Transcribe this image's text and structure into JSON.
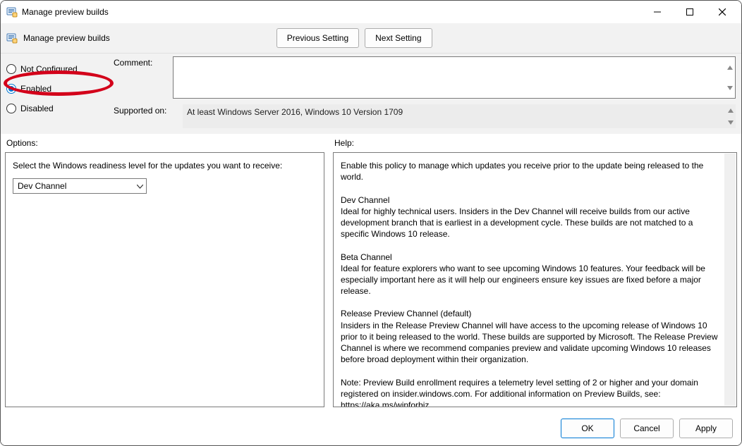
{
  "window": {
    "title": "Manage preview builds"
  },
  "subheader": {
    "title": "Manage preview builds",
    "prev": "Previous Setting",
    "next": "Next Setting"
  },
  "state": {
    "not_configured": "Not Configured",
    "enabled": "Enabled",
    "disabled": "Disabled"
  },
  "fields": {
    "comment_label": "Comment:",
    "comment_value": "",
    "supported_label": "Supported on:",
    "supported_value": "At least Windows Server 2016, Windows 10 Version 1709"
  },
  "panes": {
    "options_label": "Options:",
    "help_label": "Help:"
  },
  "options": {
    "prompt": "Select the Windows readiness level for the updates you want to receive:",
    "selected": "Dev Channel"
  },
  "help": {
    "p1": "Enable this policy to manage which updates you receive prior to the update being released to the world.",
    "h_dev": "Dev Channel",
    "p_dev": "Ideal for highly technical users. Insiders in the Dev Channel will receive builds from our active development branch that is earliest in a development cycle. These builds are not matched to a specific Windows 10 release.",
    "h_beta": "Beta Channel",
    "p_beta": "Ideal for feature explorers who want to see upcoming Windows 10 features. Your feedback will be especially important here as it will help our engineers ensure key issues are fixed before a major release.",
    "h_rp": "Release Preview Channel (default)",
    "p_rp": "Insiders in the Release Preview Channel will have access to the upcoming release of Windows 10 prior to it being released to the world. These builds are supported by Microsoft. The Release Preview Channel is where we recommend companies preview and validate upcoming Windows 10 releases before broad deployment within their organization.",
    "p_note": "Note: Preview Build enrollment requires a telemetry level setting of 2 or higher and your domain registered on insider.windows.com. For additional information on Preview Builds, see: https://aka.ms/wipforbiz"
  },
  "footer": {
    "ok": "OK",
    "cancel": "Cancel",
    "apply": "Apply"
  }
}
